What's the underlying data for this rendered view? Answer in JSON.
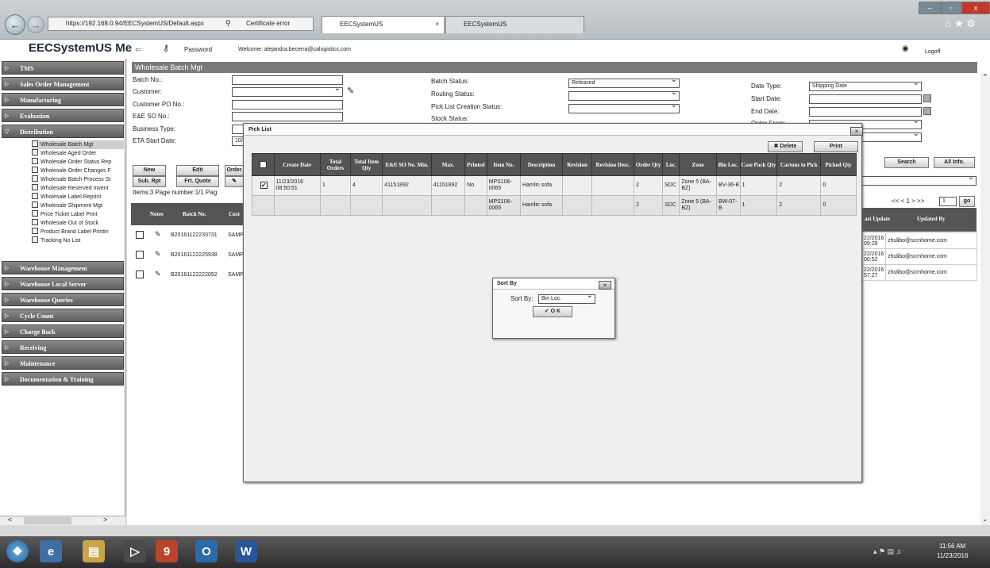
{
  "browser": {
    "url": "https://192.168.0.94/EECSystemUS/Default.aspx",
    "cert_label": "Certificate error",
    "tabs": [
      {
        "label": "EECSystemUS"
      },
      {
        "label": "EECSystemUS"
      }
    ],
    "win_controls": {
      "min": "–",
      "max": "▫",
      "close": "x"
    }
  },
  "app": {
    "title": "EECSystemUS Me",
    "password_label": "Password",
    "welcome": "Welcome: alejandra.becerra@calogistics.com",
    "logoff": "Logoff"
  },
  "sidebar": {
    "items": [
      {
        "label": "TMS"
      },
      {
        "label": "Sales Order Management"
      },
      {
        "label": "Manufacturing"
      },
      {
        "label": "Evaluation"
      },
      {
        "label": "Distribution"
      },
      {
        "label": "Warehouse Management"
      },
      {
        "label": "Warehouse Local Server"
      },
      {
        "label": "Warehouse Queries"
      },
      {
        "label": "Cycle Count"
      },
      {
        "label": "Charge Back"
      },
      {
        "label": "Receiving"
      },
      {
        "label": "Maintenance"
      },
      {
        "label": "Documentation & Training"
      }
    ],
    "sub_items": [
      {
        "label": "Wholesale Batch Mgt"
      },
      {
        "label": "Wholesale Aged Order"
      },
      {
        "label": "Wholesale Order Status Rep"
      },
      {
        "label": "Wholesale Order Changes F"
      },
      {
        "label": "Wholesale Batch Process St"
      },
      {
        "label": "Wholesale Reserved Invent"
      },
      {
        "label": "Wholesale Label Reprint"
      },
      {
        "label": "Wholesale Shipment Mgt"
      },
      {
        "label": "Price Ticket Label Print"
      },
      {
        "label": "Wholesale Out of Stock"
      },
      {
        "label": "Product Brand Label Printin"
      },
      {
        "label": "Tracking No List"
      }
    ]
  },
  "panel": {
    "title": "Wholesale Batch Mgt",
    "labels": {
      "batch_no": "Batch No.:",
      "customer": "Customer:",
      "customer_po": "Customer PO No.:",
      "ee_so": "E&E SO No.:",
      "business_type": "Business Type:",
      "eta_start": "ETA Start Date:",
      "batch_status": "Batch Status:",
      "routing_status": "Routing Status:",
      "picklist_status": "Pick List Creation Status:",
      "stock_status": "Stock Status:",
      "date_type": "Date Type:",
      "start_date": "Start Date:",
      "end_date": "End Date:",
      "order_from": "Order From:"
    },
    "values": {
      "batch_status": "Released",
      "date_type": "Shipping Date",
      "eta_start": "10/2"
    },
    "buttons": {
      "new": "New",
      "edit": "Edit",
      "order": "Order",
      "sub_rpt": "Sub. Rpt",
      "frt_quote": "Frt. Quote",
      "search": "Search",
      "all_info": "All Info."
    },
    "items_info": "Items:3  Page number:1/1  Pag",
    "pager": "<< < 1 > >>",
    "page_input": "1",
    "go": "go",
    "grid_headers": {
      "notes": "Notes",
      "batch_no": "Batch No.",
      "cust": "Cust",
      "last_update": "ast Update",
      "updated_by": "Updated By"
    },
    "rows": [
      {
        "batch": "B20161122230731",
        "cust": "SAMP",
        "update": "22/2016\n09:29",
        "by": "zhulibo@scmhome.com"
      },
      {
        "batch": "B20161122225938",
        "cust": "SAMP",
        "update": "22/2016\n00:52",
        "by": "zhulibo@scmhome.com"
      },
      {
        "batch": "B20161122222052",
        "cust": "SAMP",
        "update": "22/2016\n57:27",
        "by": "zhulibo@scmhome.com"
      }
    ]
  },
  "picklist": {
    "title": "Pick List",
    "delete": "Delete",
    "print": "Print",
    "headers": [
      "",
      "Create Date",
      "Total Orders",
      "Total Item Qty",
      "E&E SO No. Min.",
      "Max.",
      "Printed",
      "Item No.",
      "Description",
      "Revision",
      "Revision Desc.",
      "Order Qty",
      "Loc.",
      "Zone",
      "Bin Loc.",
      "Case Pack Qty",
      "Cartons to Pick",
      "Picked Qty"
    ],
    "rows": [
      [
        "✔",
        "11/23/2016 08:50:51",
        "1",
        "4",
        "41151892",
        "41151892",
        "No",
        "MPS106-0065",
        "Hamlin sofa",
        "",
        "",
        "2",
        "SDC",
        "Zone 5 (BA-BZ)",
        "BV-36-B",
        "1",
        "2",
        "0"
      ],
      [
        "",
        "",
        "",
        "",
        "",
        "",
        "",
        "MPS106-0065",
        "Hamlin sofa",
        "",
        "",
        "2",
        "SDC",
        "Zone 5 (BA-BZ)",
        "BW-07-B",
        "1",
        "2",
        "0"
      ]
    ]
  },
  "sortby": {
    "title": "Sort By",
    "label": "Sort By:",
    "value": "Bin Loc.",
    "ok": "O K"
  },
  "taskbar": {
    "time": "11:56 AM",
    "date": "11/23/2016"
  }
}
